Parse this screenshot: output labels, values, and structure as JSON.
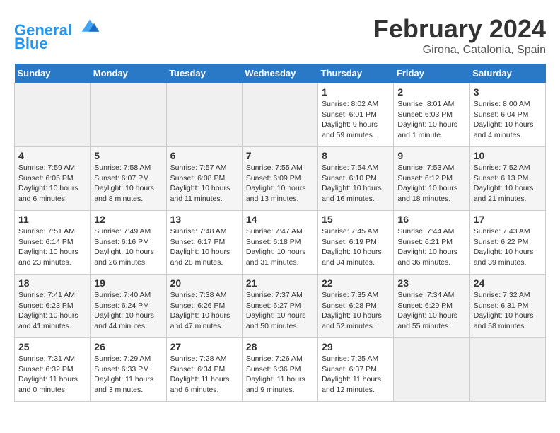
{
  "header": {
    "logo_line1": "General",
    "logo_line2": "Blue",
    "month_title": "February 2024",
    "location": "Girona, Catalonia, Spain"
  },
  "weekdays": [
    "Sunday",
    "Monday",
    "Tuesday",
    "Wednesday",
    "Thursday",
    "Friday",
    "Saturday"
  ],
  "weeks": [
    [
      {
        "num": "",
        "info": ""
      },
      {
        "num": "",
        "info": ""
      },
      {
        "num": "",
        "info": ""
      },
      {
        "num": "",
        "info": ""
      },
      {
        "num": "1",
        "info": "Sunrise: 8:02 AM\nSunset: 6:01 PM\nDaylight: 9 hours\nand 59 minutes."
      },
      {
        "num": "2",
        "info": "Sunrise: 8:01 AM\nSunset: 6:03 PM\nDaylight: 10 hours\nand 1 minute."
      },
      {
        "num": "3",
        "info": "Sunrise: 8:00 AM\nSunset: 6:04 PM\nDaylight: 10 hours\nand 4 minutes."
      }
    ],
    [
      {
        "num": "4",
        "info": "Sunrise: 7:59 AM\nSunset: 6:05 PM\nDaylight: 10 hours\nand 6 minutes."
      },
      {
        "num": "5",
        "info": "Sunrise: 7:58 AM\nSunset: 6:07 PM\nDaylight: 10 hours\nand 8 minutes."
      },
      {
        "num": "6",
        "info": "Sunrise: 7:57 AM\nSunset: 6:08 PM\nDaylight: 10 hours\nand 11 minutes."
      },
      {
        "num": "7",
        "info": "Sunrise: 7:55 AM\nSunset: 6:09 PM\nDaylight: 10 hours\nand 13 minutes."
      },
      {
        "num": "8",
        "info": "Sunrise: 7:54 AM\nSunset: 6:10 PM\nDaylight: 10 hours\nand 16 minutes."
      },
      {
        "num": "9",
        "info": "Sunrise: 7:53 AM\nSunset: 6:12 PM\nDaylight: 10 hours\nand 18 minutes."
      },
      {
        "num": "10",
        "info": "Sunrise: 7:52 AM\nSunset: 6:13 PM\nDaylight: 10 hours\nand 21 minutes."
      }
    ],
    [
      {
        "num": "11",
        "info": "Sunrise: 7:51 AM\nSunset: 6:14 PM\nDaylight: 10 hours\nand 23 minutes."
      },
      {
        "num": "12",
        "info": "Sunrise: 7:49 AM\nSunset: 6:16 PM\nDaylight: 10 hours\nand 26 minutes."
      },
      {
        "num": "13",
        "info": "Sunrise: 7:48 AM\nSunset: 6:17 PM\nDaylight: 10 hours\nand 28 minutes."
      },
      {
        "num": "14",
        "info": "Sunrise: 7:47 AM\nSunset: 6:18 PM\nDaylight: 10 hours\nand 31 minutes."
      },
      {
        "num": "15",
        "info": "Sunrise: 7:45 AM\nSunset: 6:19 PM\nDaylight: 10 hours\nand 34 minutes."
      },
      {
        "num": "16",
        "info": "Sunrise: 7:44 AM\nSunset: 6:21 PM\nDaylight: 10 hours\nand 36 minutes."
      },
      {
        "num": "17",
        "info": "Sunrise: 7:43 AM\nSunset: 6:22 PM\nDaylight: 10 hours\nand 39 minutes."
      }
    ],
    [
      {
        "num": "18",
        "info": "Sunrise: 7:41 AM\nSunset: 6:23 PM\nDaylight: 10 hours\nand 41 minutes."
      },
      {
        "num": "19",
        "info": "Sunrise: 7:40 AM\nSunset: 6:24 PM\nDaylight: 10 hours\nand 44 minutes."
      },
      {
        "num": "20",
        "info": "Sunrise: 7:38 AM\nSunset: 6:26 PM\nDaylight: 10 hours\nand 47 minutes."
      },
      {
        "num": "21",
        "info": "Sunrise: 7:37 AM\nSunset: 6:27 PM\nDaylight: 10 hours\nand 50 minutes."
      },
      {
        "num": "22",
        "info": "Sunrise: 7:35 AM\nSunset: 6:28 PM\nDaylight: 10 hours\nand 52 minutes."
      },
      {
        "num": "23",
        "info": "Sunrise: 7:34 AM\nSunset: 6:29 PM\nDaylight: 10 hours\nand 55 minutes."
      },
      {
        "num": "24",
        "info": "Sunrise: 7:32 AM\nSunset: 6:31 PM\nDaylight: 10 hours\nand 58 minutes."
      }
    ],
    [
      {
        "num": "25",
        "info": "Sunrise: 7:31 AM\nSunset: 6:32 PM\nDaylight: 11 hours\nand 0 minutes."
      },
      {
        "num": "26",
        "info": "Sunrise: 7:29 AM\nSunset: 6:33 PM\nDaylight: 11 hours\nand 3 minutes."
      },
      {
        "num": "27",
        "info": "Sunrise: 7:28 AM\nSunset: 6:34 PM\nDaylight: 11 hours\nand 6 minutes."
      },
      {
        "num": "28",
        "info": "Sunrise: 7:26 AM\nSunset: 6:36 PM\nDaylight: 11 hours\nand 9 minutes."
      },
      {
        "num": "29",
        "info": "Sunrise: 7:25 AM\nSunset: 6:37 PM\nDaylight: 11 hours\nand 12 minutes."
      },
      {
        "num": "",
        "info": ""
      },
      {
        "num": "",
        "info": ""
      }
    ]
  ]
}
